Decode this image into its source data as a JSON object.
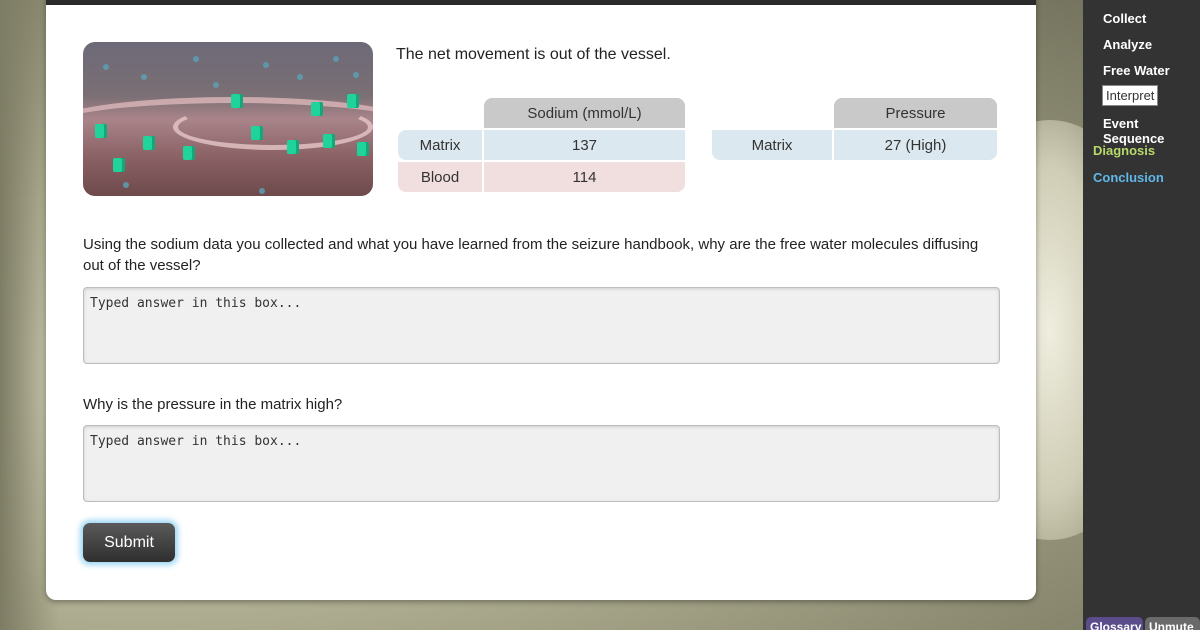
{
  "net_movement": "The net movement is out of the vessel.",
  "sodium_table": {
    "header": "Sodium (mmol/L)",
    "rows": [
      {
        "label": "Matrix",
        "value": "137"
      },
      {
        "label": "Blood",
        "value": "114"
      }
    ]
  },
  "pressure_table": {
    "header": "Pressure",
    "rows": [
      {
        "label": "Matrix",
        "value": "27 (High)"
      }
    ]
  },
  "questions": [
    {
      "text": "Using the sodium data you collected and what you have learned from the seizure handbook, why are the free water molecules diffusing out of the vessel?",
      "placeholder": "Typed answer in this box..."
    },
    {
      "text": "Why is the pressure in the matrix high?",
      "placeholder": "Typed answer in this box..."
    }
  ],
  "submit_label": "Submit",
  "sidebar": {
    "items": [
      "Collect",
      "Analyze",
      "Free Water",
      "Interpret",
      "Event Sequence",
      "Diagnosis",
      "Conclusion"
    ],
    "active": "Interpret",
    "colors": {
      "diagnosis": "#b6d96a",
      "conclusion": "#5fb8e8"
    },
    "bottom_tabs": [
      "Glossary",
      "Unmute"
    ]
  },
  "hero_image": {
    "icon": "blood-vessel-illustration"
  }
}
